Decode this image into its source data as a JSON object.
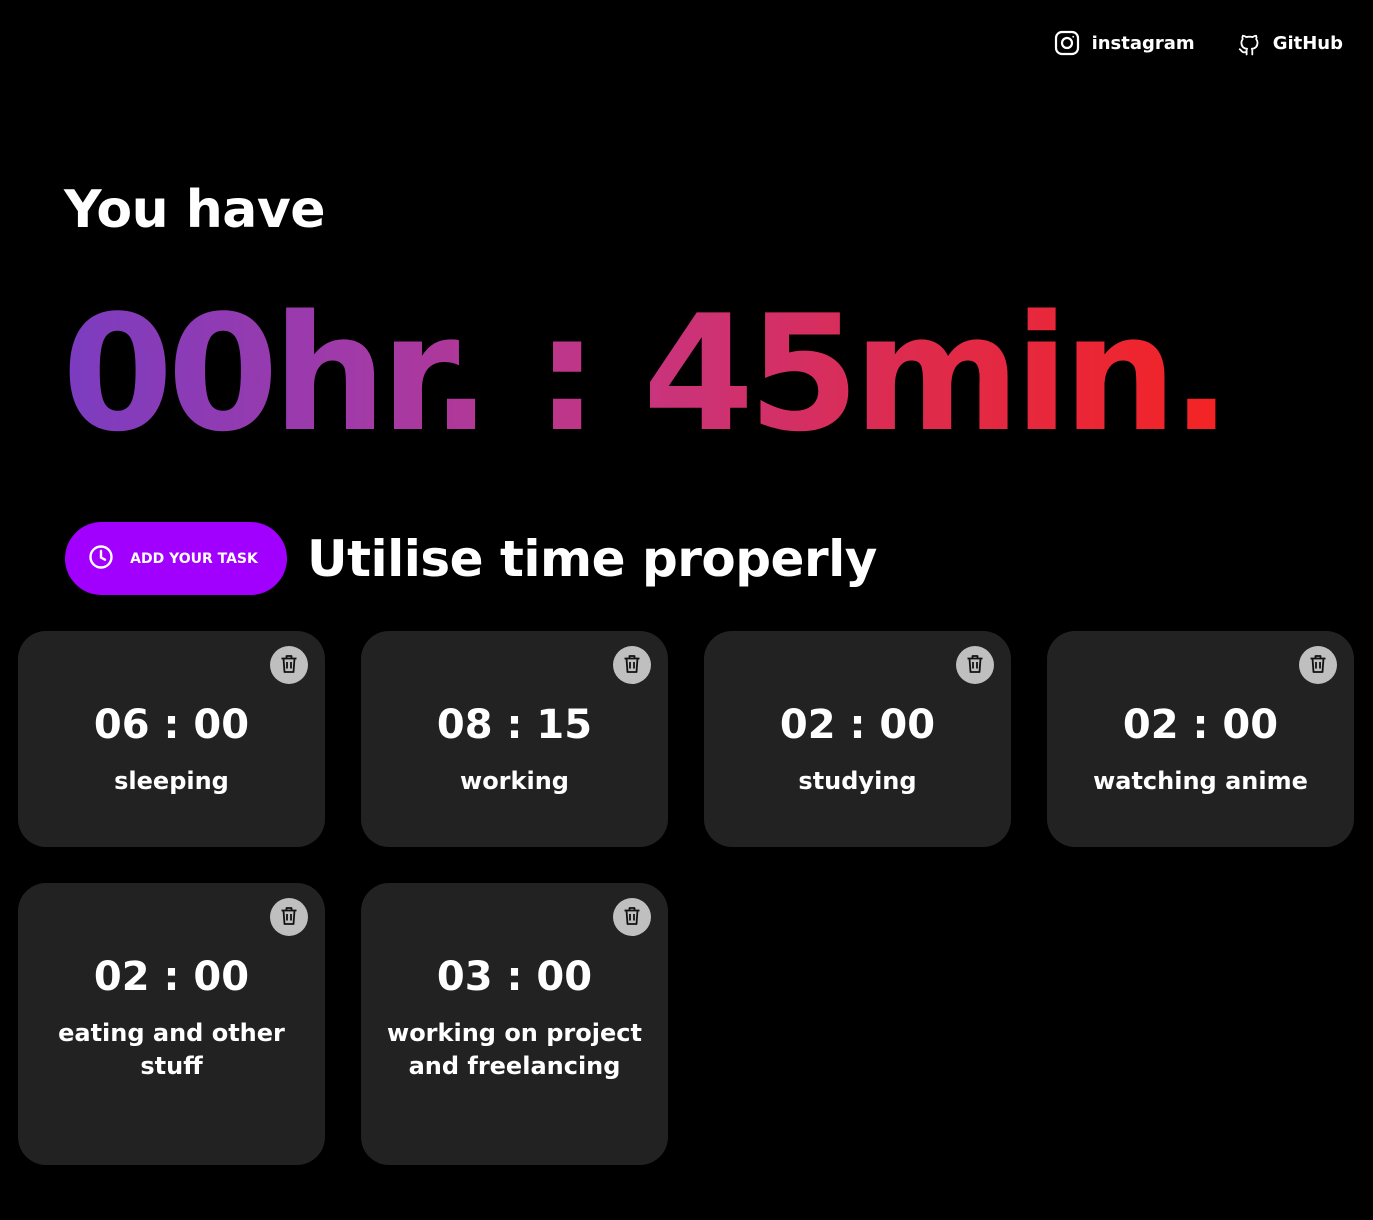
{
  "nav": {
    "instagram": {
      "label": "instagram",
      "icon": "instagram-icon"
    },
    "github": {
      "label": "GitHub",
      "icon": "github-icon"
    }
  },
  "header": {
    "intro": "You have",
    "remaining": "00hr. : 45min.",
    "gradient_colors": [
      "#7b3cc0",
      "#f42323"
    ]
  },
  "actions": {
    "add_task_label": "ADD YOUR TASK",
    "add_task_icon": "clock-icon",
    "accent_color": "#a100ff",
    "tagline": "Utilise time properly"
  },
  "tasks": [
    {
      "time": "06 : 00",
      "name": "sleeping"
    },
    {
      "time": "08 : 15",
      "name": "working"
    },
    {
      "time": "02 : 00",
      "name": "studying"
    },
    {
      "time": "02 : 00",
      "name": "watching anime"
    },
    {
      "time": "02 : 00",
      "name": "eating and other stuff"
    },
    {
      "time": "03 : 00",
      "name": "working on project and freelancing"
    }
  ],
  "task_delete_icon": "trash-icon"
}
